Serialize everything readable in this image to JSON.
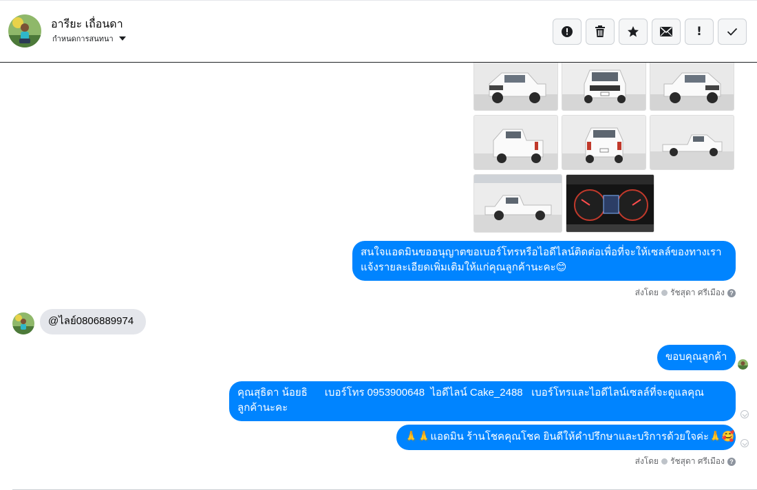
{
  "contact": {
    "name": "อารียะ เถื่อนดา",
    "assign_label": "กำหนดการสนทนา"
  },
  "toolbar": {
    "buttons": [
      {
        "name": "spam-button",
        "icon": "alert-circle-icon"
      },
      {
        "name": "delete-button",
        "icon": "trash-icon"
      },
      {
        "name": "star-button",
        "icon": "star-icon"
      },
      {
        "name": "mark-unread-button",
        "icon": "envelope-icon"
      },
      {
        "name": "follow-up-button",
        "icon": "exclamation-icon"
      },
      {
        "name": "mark-done-button",
        "icon": "check-icon"
      }
    ]
  },
  "messages": {
    "request_contact": {
      "line1": "สนใจแอดมินขออนุญาตขอเบอร์โทรหรือไอดีไลน์ติดต่อเพื่อที่จะให้เซลล์ของทางเรา",
      "line2": "แจ้งรายละเอียดเพิ่มเติมให้แก่คุณลูกค้านะคะ😊"
    },
    "customer_line": "@ไลย์0806889974",
    "thanks": "ขอบคุณลูกค้า",
    "sales_info": {
      "line1": "คุณสุธิดา น้อยธิ      เบอร์โทร 0953900648  ไอดีไลน์ Cake_2488   เบอร์โทรและไอดีไลน์เซลล์ที่จะดูแลคุณ",
      "line2": "ลูกค้านะคะ"
    },
    "signoff": "🙏🙏แอดมิน ร้านโชคคุณโชค ยินดีให้คำปรึกษาและบริการด้วยใจค่ะ🙏🥰"
  },
  "sent_by": {
    "label": "ส่งโดย",
    "agent": "รัชสุดา ศรีเมือง",
    "help": "?"
  },
  "colors": {
    "outgoing_bubble": "#0084ff",
    "incoming_bubble": "#e4e6eb"
  }
}
